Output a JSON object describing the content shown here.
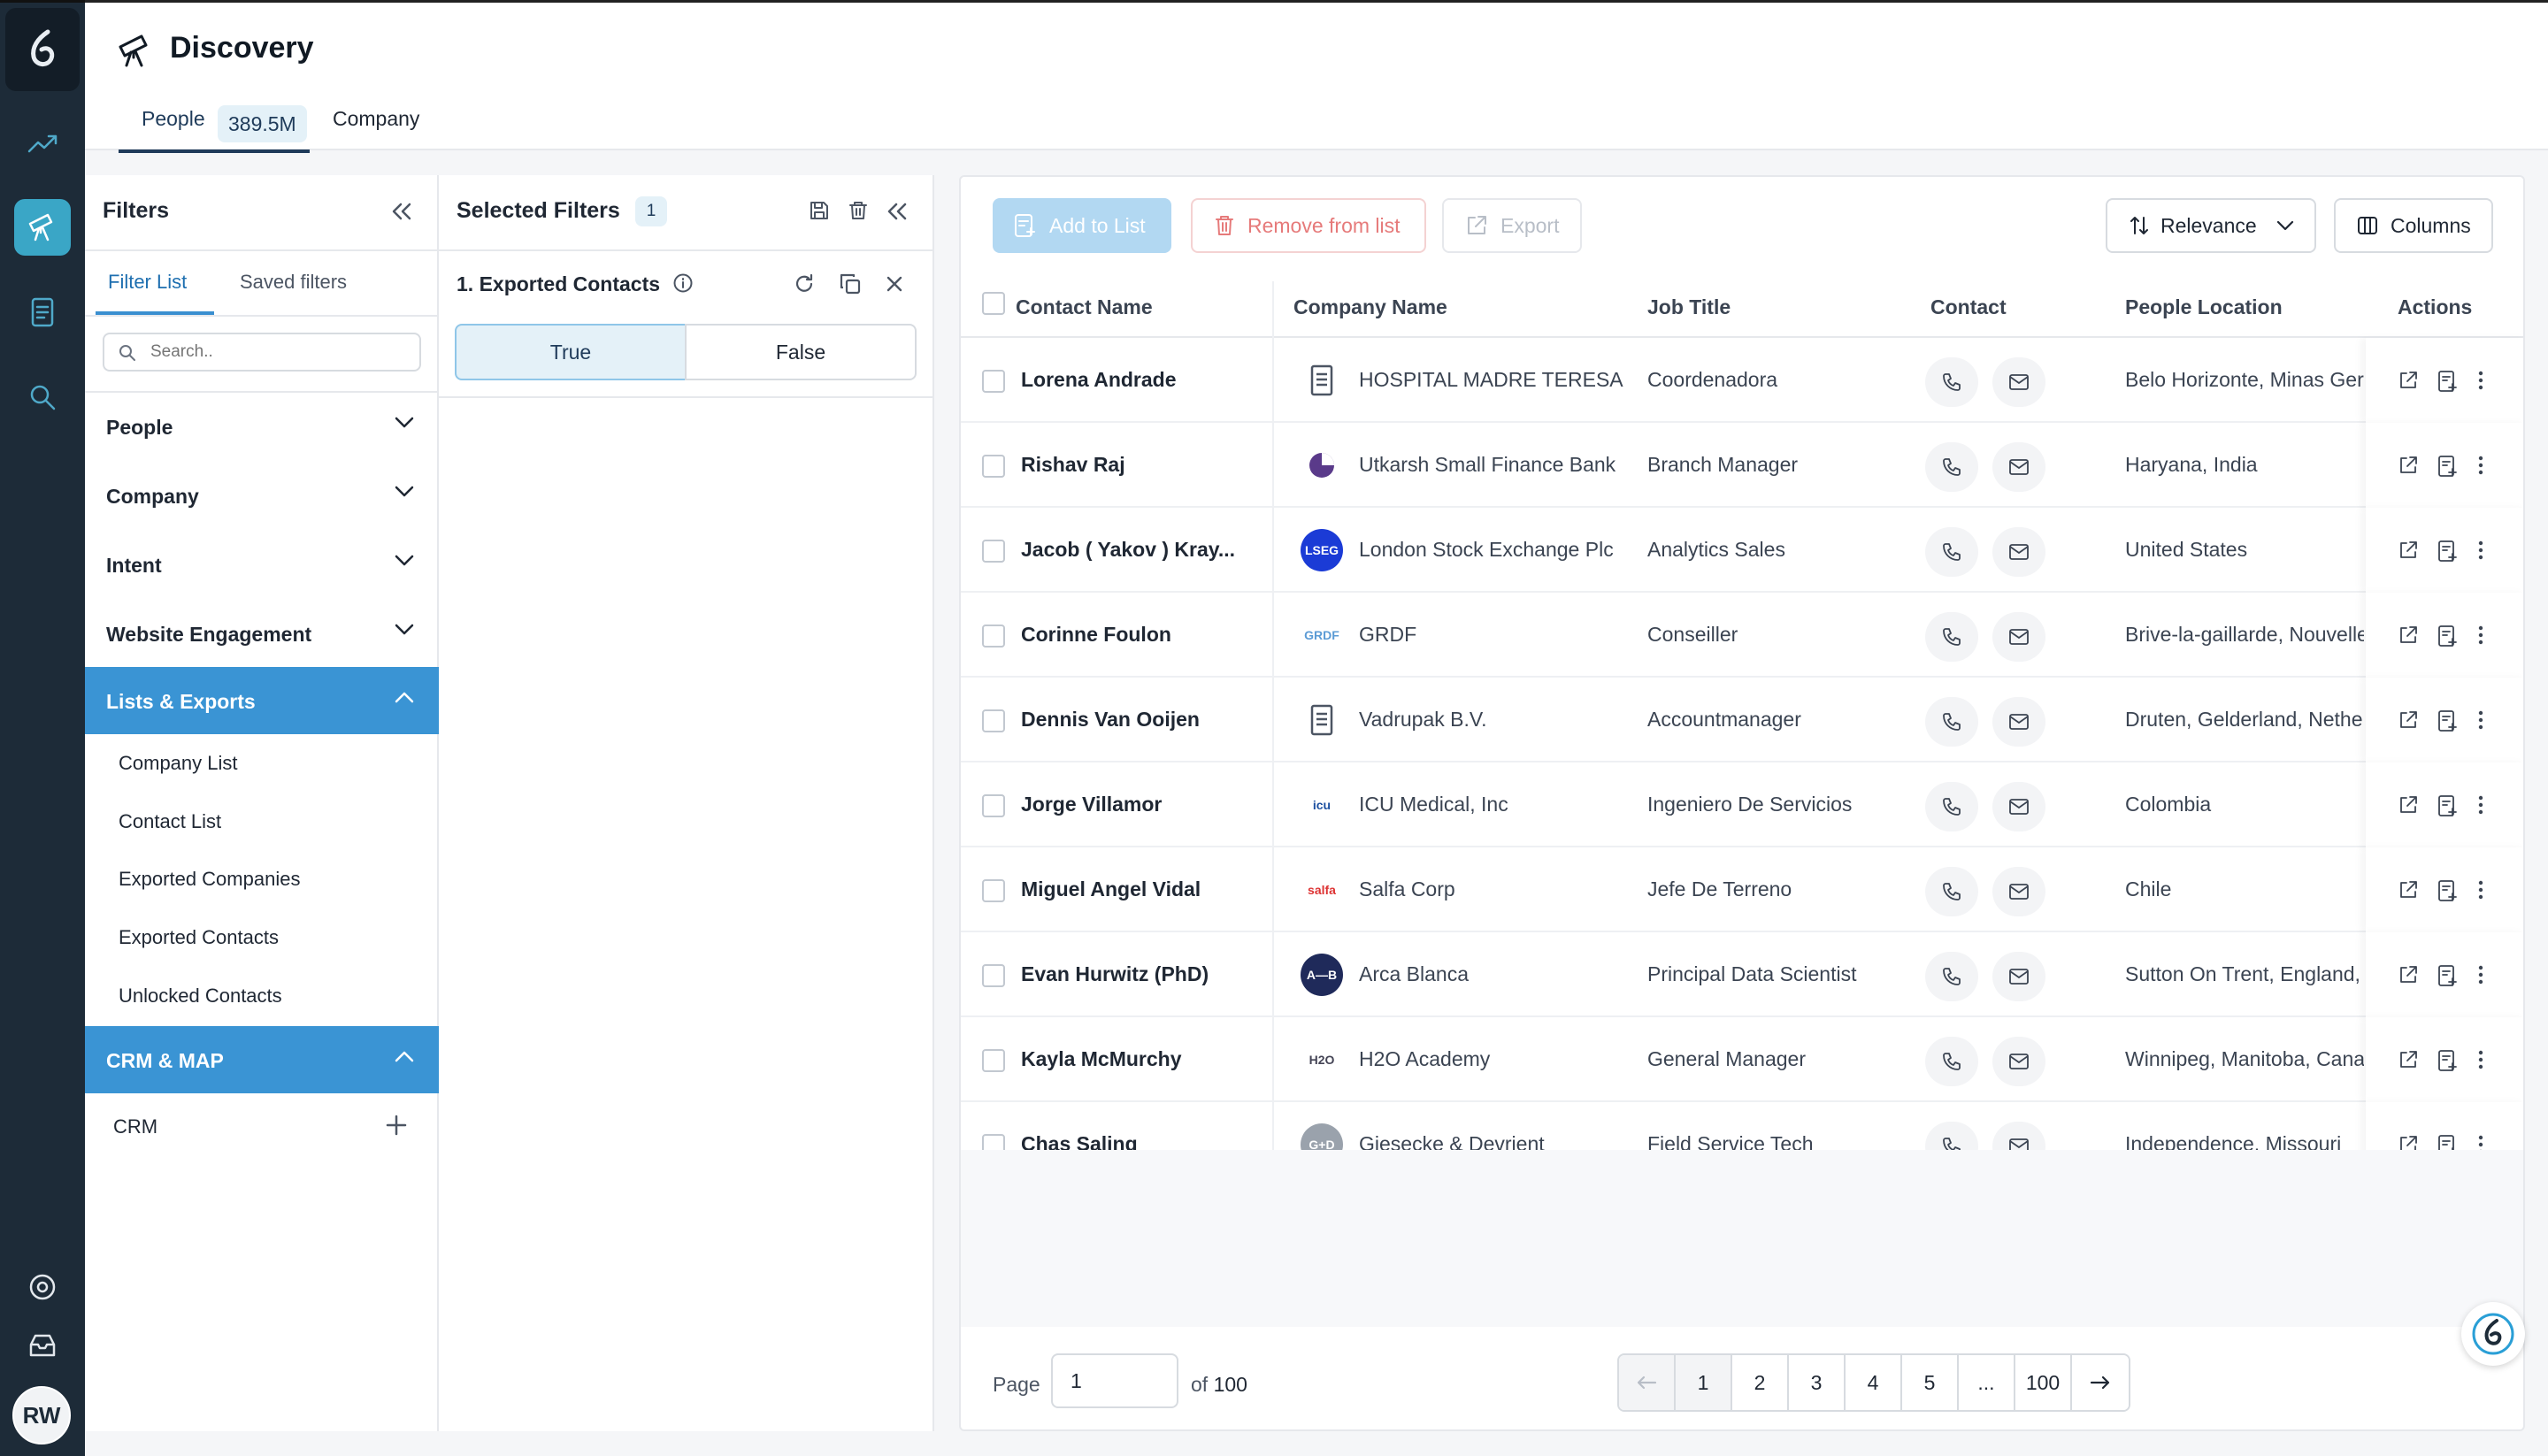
{
  "app": {
    "title": "Discovery",
    "rail": {
      "logo_icon": "brand-logo-icon",
      "avatar_initials": "RW",
      "items": [
        "trending-icon",
        "telescope-icon",
        "document-icon",
        "search-icon",
        "settings-icon",
        "inbox-icon"
      ]
    }
  },
  "header": {
    "tabs": [
      {
        "label": "People",
        "count": "389.5M"
      },
      {
        "label": "Company"
      }
    ]
  },
  "filters": {
    "title": "Filters",
    "subtabs": [
      "Filter List",
      "Saved filters"
    ],
    "search_placeholder": "Search..",
    "sections": [
      "People",
      "Company",
      "Intent",
      "Website Engagement",
      "Lists & Exports",
      "CRM & MAP"
    ],
    "lists_exports_items": [
      "Company List",
      "Contact List",
      "Exported Companies",
      "Exported Contacts",
      "Unlocked Contacts"
    ],
    "crm_items": [
      "CRM"
    ]
  },
  "selected_filters": {
    "title": "Selected Filters",
    "count": "1",
    "filter": {
      "title": "1. Exported Contacts",
      "options": [
        "True",
        "False"
      ],
      "selected": "True"
    }
  },
  "toolbar": {
    "add_to_list": "Add to List",
    "remove_from_list": "Remove from list",
    "export": "Export",
    "sort": "Relevance",
    "columns": "Columns"
  },
  "table": {
    "headers": [
      "Contact Name",
      "Company Name",
      "Job Title",
      "Contact",
      "People Location",
      "Actions"
    ],
    "rows": [
      {
        "name": "Lorena Andrade",
        "company": "HOSPITAL MADRE TERESA",
        "job": "Coordenadora",
        "location": "Belo Horizonte, Minas Gerais"
      },
      {
        "name": "Rishav Raj",
        "company": "Utkarsh Small Finance Bank",
        "job": "Branch Manager",
        "location": "Haryana, India"
      },
      {
        "name": "Jacob ( Yakov ) Kray...",
        "company": "London Stock Exchange Plc",
        "job": "Analytics Sales",
        "location": "United States"
      },
      {
        "name": "Corinne Foulon",
        "company": "GRDF",
        "job": "Conseiller",
        "location": "Brive-la-gaillarde, Nouvelle"
      },
      {
        "name": "Dennis Van Ooijen",
        "company": "Vadrupak B.V.",
        "job": "Accountmanager",
        "location": "Druten, Gelderland, Netherlands"
      },
      {
        "name": "Jorge Villamor",
        "company": "ICU Medical, Inc",
        "job": "Ingeniero De Servicios",
        "location": "Colombia"
      },
      {
        "name": "Miguel Angel Vidal",
        "company": "Salfa Corp",
        "job": "Jefe De Terreno",
        "location": "Chile"
      },
      {
        "name": "Evan Hurwitz (PhD)",
        "company": "Arca Blanca",
        "job": "Principal Data Scientist",
        "location": "Sutton On Trent, England,"
      },
      {
        "name": "Kayla McMurchy",
        "company": "H2O Academy",
        "job": "General Manager",
        "location": "Winnipeg, Manitoba, Canada"
      },
      {
        "name": "Chas Saling",
        "company": "Giesecke & Devrient",
        "job": "Field Service Tech",
        "location": "Independence, Missouri"
      }
    ]
  },
  "pagination": {
    "page_label": "Page",
    "current_page": "1",
    "of_label": "of",
    "total_pages": "100",
    "pages": [
      "1",
      "2",
      "3",
      "4",
      "5",
      "...",
      "100"
    ]
  }
}
